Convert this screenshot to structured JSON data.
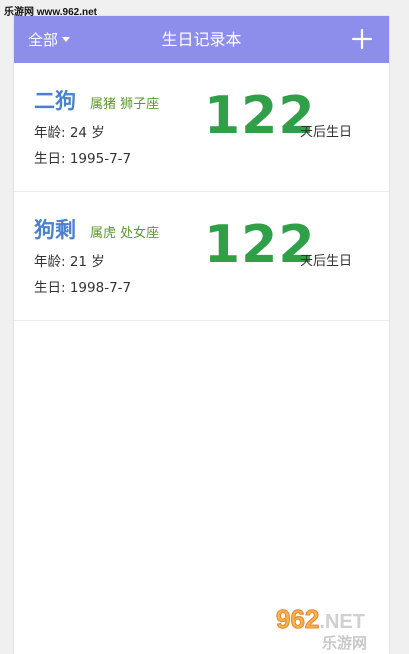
{
  "watermark": {
    "top_text": "乐游网 www.962.net",
    "logo_main": "962",
    "logo_net": ".NET",
    "logo_sub": "乐游网"
  },
  "colors": {
    "topbar": "#8d8deb",
    "name": "#4a80d0",
    "zodiac": "#5b9a2c",
    "days": "#2fa048"
  },
  "header": {
    "filter_label": "全部",
    "filter_icon": "caret-down-icon",
    "title": "生日记录本",
    "add_icon": "plus-icon"
  },
  "records": [
    {
      "name": "二狗",
      "zodiac": "属猪 狮子座",
      "age": "年龄: 24 岁",
      "birthday": "生日: 1995-7-7",
      "days": "122",
      "days_label": "天后生日"
    },
    {
      "name": "狗剩",
      "zodiac": "属虎 处女座",
      "age": "年龄: 21 岁",
      "birthday": "生日: 1998-7-7",
      "days": "122",
      "days_label": "天后生日"
    }
  ]
}
